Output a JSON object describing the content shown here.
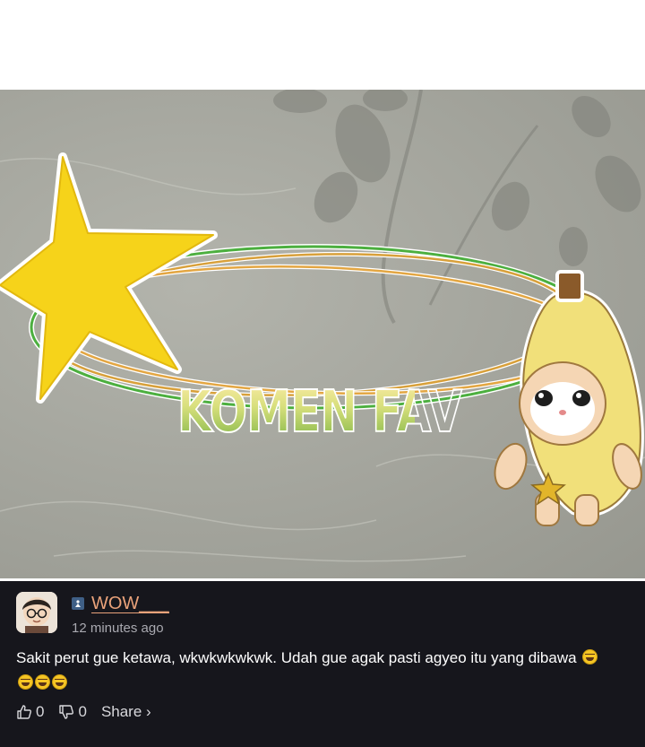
{
  "banner": {
    "title": "KOMEN  FAV"
  },
  "comment": {
    "username": "WOW___",
    "timestamp": "12 minutes ago",
    "text": "Sakit perut gue ketawa, wkwkwkwkwk. Udah gue agak pasti agyeo itu yang dibawa",
    "emoji_names": [
      "rolling-on-floor-laughing-icon",
      "rolling-on-floor-laughing-icon",
      "rolling-on-floor-laughing-icon",
      "rolling-on-floor-laughing-icon"
    ],
    "upvotes": "0",
    "downvotes": "0",
    "share_label": "Share ›"
  },
  "colors": {
    "banner_bg": "#a3a49c",
    "comment_bg": "#16161c",
    "username": "#e9a27a",
    "star": "#f6d31a"
  }
}
